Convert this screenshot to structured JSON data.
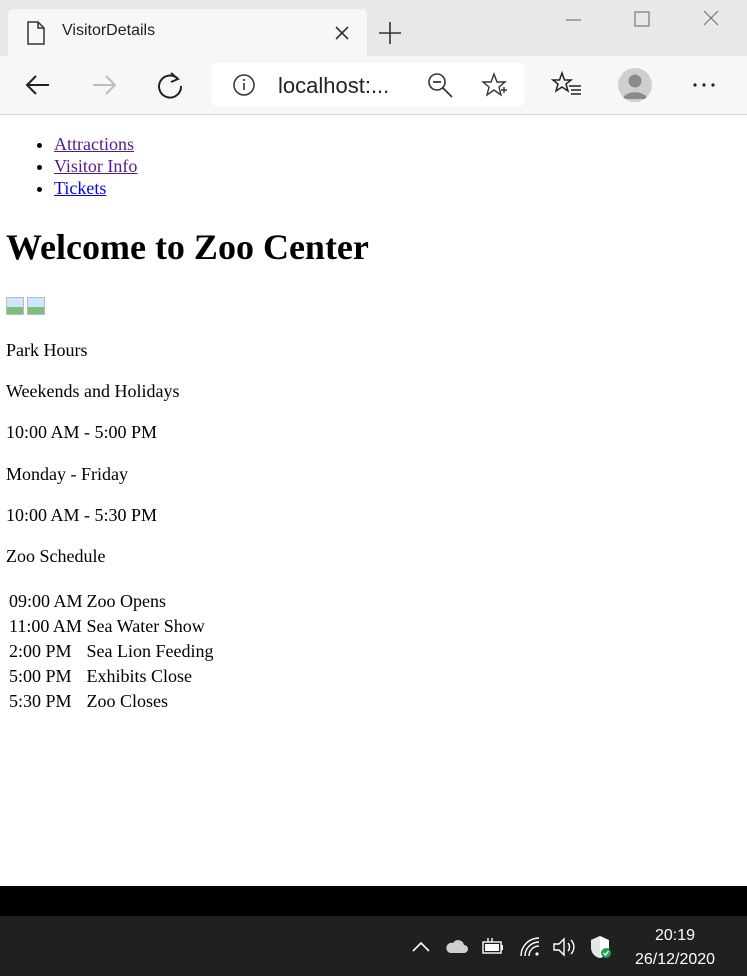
{
  "browser": {
    "tab_title": "VisitorDetails",
    "address": "localhost:..."
  },
  "page": {
    "nav": [
      "Attractions",
      "Visitor Info",
      "Tickets"
    ],
    "heading": "Welcome to Zoo Center",
    "park_hours_title": "Park Hours",
    "weekend_label": "Weekends and Holidays",
    "weekend_hours": "10:00 AM - 5:00 PM",
    "weekday_label": "Monday - Friday",
    "weekday_hours": "10:00 AM - 5:30 PM",
    "schedule_title": "Zoo Schedule",
    "schedule": [
      {
        "time": "09:00 AM",
        "event": "Zoo Opens"
      },
      {
        "time": "11:00 AM",
        "event": "Sea Water Show"
      },
      {
        "time": "2:00 PM",
        "event": "Sea Lion Feeding"
      },
      {
        "time": "5:00 PM",
        "event": "Exhibits Close"
      },
      {
        "time": "5:30 PM",
        "event": "Zoo Closes"
      }
    ]
  },
  "taskbar": {
    "time": "20:19",
    "date": "26/12/2020"
  }
}
